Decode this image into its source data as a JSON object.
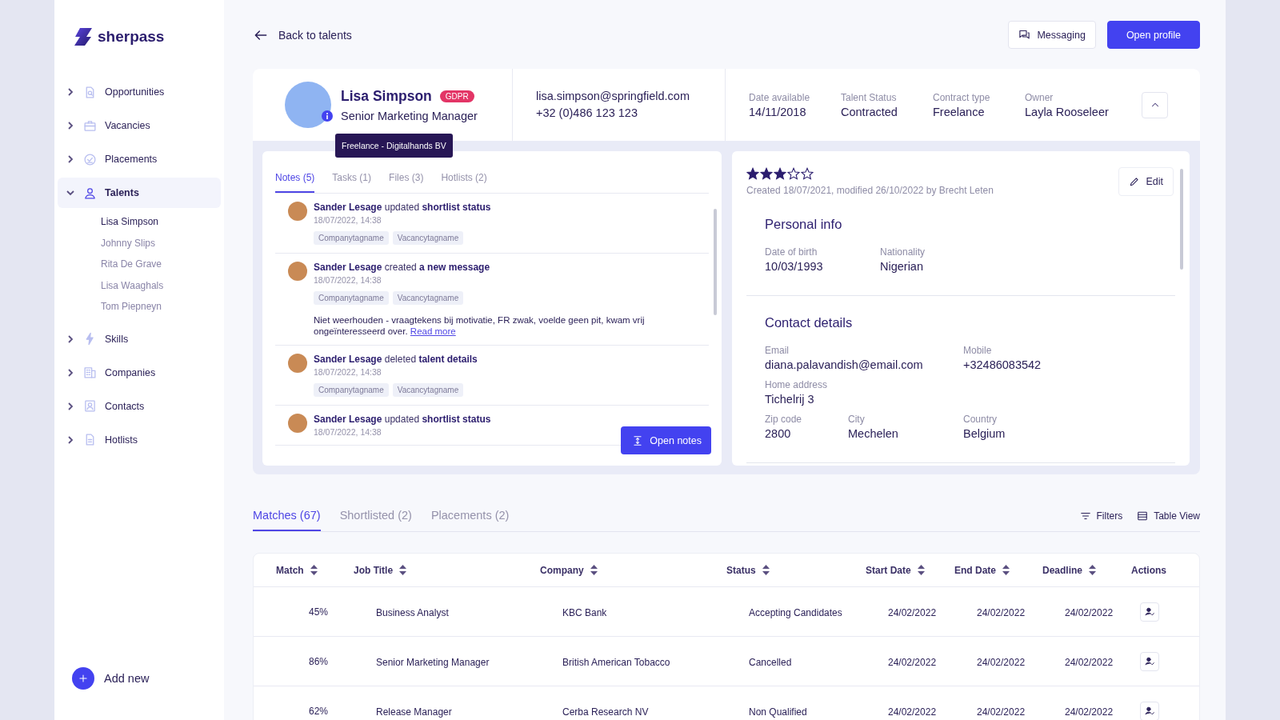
{
  "sidebar": {
    "logo": "sherpass",
    "items": [
      {
        "label": "Opportunities",
        "expanded": false,
        "selected": false
      },
      {
        "label": "Vacancies",
        "expanded": false,
        "selected": false
      },
      {
        "label": "Placements",
        "expanded": false,
        "selected": false
      },
      {
        "label": "Talents",
        "expanded": true,
        "selected": true,
        "children": [
          {
            "label": "Lisa Simpson",
            "selected": true
          },
          {
            "label": "Johnny Slips",
            "selected": false
          },
          {
            "label": "Rita De Grave",
            "selected": false
          },
          {
            "label": "Lisa Waaghals",
            "selected": false
          },
          {
            "label": "Tom Piepneyn",
            "selected": false
          }
        ]
      },
      {
        "label": "Skills",
        "expanded": false,
        "selected": false
      },
      {
        "label": "Companies",
        "expanded": false,
        "selected": false
      },
      {
        "label": "Contacts",
        "expanded": false,
        "selected": false
      },
      {
        "label": "Hotlists",
        "expanded": false,
        "selected": false
      }
    ],
    "add_button": "Add new"
  },
  "topbar": {
    "back": "Back to talents",
    "buttons": [
      {
        "label": "Messaging",
        "kind": "secondary"
      },
      {
        "label": "Open profile",
        "kind": "primary"
      }
    ]
  },
  "profile": {
    "name": "Lisa Simpson",
    "badge": "GDPR",
    "title": "Senior Marketing Manager",
    "tooltip": "Freelance - Digitalhands BV",
    "email": "lisa.simpson@springfield.com",
    "phone": "+32 (0)486 123 123",
    "fields": [
      {
        "label": "Date available",
        "value": "14/11/2018"
      },
      {
        "label": "Talent Status",
        "value": "Contracted"
      },
      {
        "label": "Contract type",
        "value": "Freelance"
      },
      {
        "label": "Owner",
        "value": "Layla Rooseleer"
      }
    ]
  },
  "notes": {
    "tabs": [
      {
        "label": "Notes (5)",
        "selected": true
      },
      {
        "label": "Tasks (1)",
        "selected": false
      },
      {
        "label": "Files (3)",
        "selected": false
      },
      {
        "label": "Hotlists (2)",
        "selected": false
      }
    ],
    "items": [
      {
        "text": "**Sander Lesage** updated **shortlist status**",
        "date": "18/07/2022, 14:38",
        "tags": [
          "Companytagname",
          "Vacancytagname"
        ]
      },
      {
        "text": "**Sander Lesage** created **a new message**",
        "date": "18/07/2022, 14:38",
        "tags": [
          "Companytagname",
          "Vacancytagname"
        ],
        "body": "Niet weerhouden - vraagtekens bij motivatie, FR zwak, voelde geen pit, kwam vrij ongeïnteresseerd over.",
        "link": "Read more"
      },
      {
        "text": "**Sander Lesage** deleted **talent details**",
        "date": "18/07/2022, 14:38",
        "tags": [
          "Companytagname",
          "Vacancytagname"
        ]
      },
      {
        "text": "**Sander Lesage** updated **shortlist status**",
        "date": "18/07/2022, 14:38"
      }
    ],
    "button": "Open notes"
  },
  "details": {
    "stars": 3,
    "meta": "Created 18/07/2021, modified 26/10/2022 by Brecht Leten",
    "edit": "Edit",
    "sections": [
      {
        "title": "Personal info",
        "rows": [
          [
            {
              "label": "Date of birth",
              "value": "10/03/1993"
            },
            {
              "label": "Nationality",
              "value": "Nigerian"
            }
          ]
        ]
      },
      {
        "title": "Contact details",
        "rows": [
          [
            {
              "label": "Email",
              "value": "diana.palavandish@email.com"
            },
            "",
            {
              "label": "Mobile",
              "value": "+32486083542"
            }
          ],
          [
            {
              "label": "Home address",
              "value": "Tichelrij 3"
            }
          ],
          [
            {
              "label": "Zip code",
              "value": "2800"
            },
            {
              "label": "City",
              "value": "Mechelen"
            },
            {
              "label": "Country",
              "value": "Belgium"
            }
          ]
        ]
      }
    ]
  },
  "matches": {
    "tabs": [
      {
        "label": "Matches (67)",
        "selected": true
      },
      {
        "label": "Shortlisted (2)",
        "selected": false
      },
      {
        "label": "Placements (2)",
        "selected": false
      }
    ],
    "tools": [
      {
        "label": "Filters"
      },
      {
        "label": "Table View"
      }
    ],
    "columns": [
      {
        "label": "Match",
        "sortable": true
      },
      {
        "label": "Job Title",
        "sortable": true
      },
      {
        "label": "Company",
        "sortable": true
      },
      {
        "label": "Status",
        "sortable": true
      },
      {
        "label": "Start Date",
        "sortable": true
      },
      {
        "label": "End Date",
        "sortable": true
      },
      {
        "label": "Deadline",
        "sortable": true
      },
      {
        "label": "Actions",
        "sortable": false
      }
    ],
    "rows": [
      [
        "45%",
        "Business Analyst",
        "KBC Bank",
        "Accepting Candidates",
        "24/02/2022",
        "24/02/2022",
        "24/02/2022"
      ],
      [
        "86%",
        "Senior Marketing Manager",
        "British American Tobacco",
        "Cancelled",
        "24/02/2022",
        "24/02/2022",
        "24/02/2022"
      ],
      [
        "62%",
        "Release Manager",
        "Cerba Research NV",
        "Non Qualified",
        "24/02/2022",
        "24/02/2022",
        "24/02/2022"
      ]
    ]
  }
}
